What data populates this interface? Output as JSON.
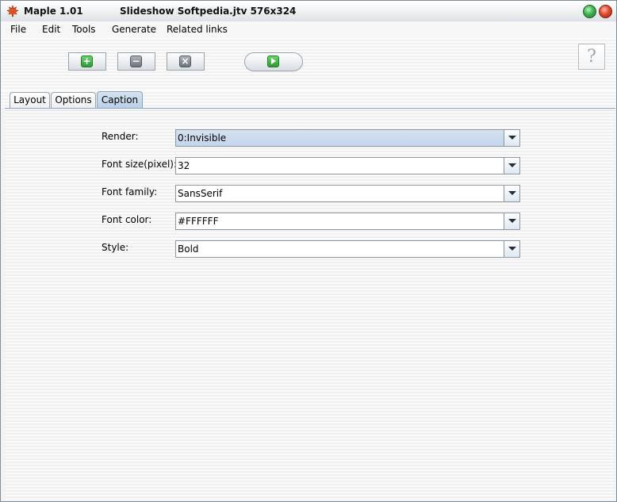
{
  "window": {
    "app_title": "Maple 1.01",
    "doc_title": "Slideshow Softpedia.jtv 576x324"
  },
  "menu": {
    "items": [
      "File",
      "Edit",
      "Tools",
      "Generate",
      "Related links"
    ]
  },
  "toolbar": {
    "help_label": "?"
  },
  "tabs": [
    {
      "label": "Layout",
      "active": false
    },
    {
      "label": "Options",
      "active": false
    },
    {
      "label": "Caption",
      "active": true
    }
  ],
  "caption_form": {
    "fields": [
      {
        "label": "Render:",
        "value": "0:Invisible"
      },
      {
        "label": "Font size(pixel):",
        "value": "32"
      },
      {
        "label": "Font family:",
        "value": "SansSerif"
      },
      {
        "label": "Font color:",
        "value": "#FFFFFF"
      },
      {
        "label": "Style:",
        "value": "Bold"
      }
    ]
  },
  "colors": {
    "accent": "#b9cfe6",
    "maximize": "#3fb24f",
    "close": "#e04b2f"
  }
}
